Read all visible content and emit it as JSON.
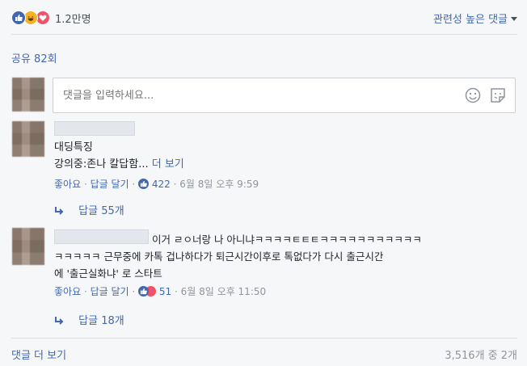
{
  "reactions": {
    "count": "1.2만명",
    "icons": [
      "like-icon",
      "haha-icon",
      "love-icon"
    ]
  },
  "sort": {
    "label": "관련성 높은 댓글"
  },
  "shares": {
    "label": "공유 82회"
  },
  "compose": {
    "placeholder": "댓글을 입력하세요..."
  },
  "comments": [
    {
      "line1": "대딩특징",
      "line2": "강의중:존나 칼답함...",
      "more": "더 보기",
      "like": "좋아요",
      "reply": "답글 달기",
      "reaction_count": "422",
      "time": "6월 8일 오후 9:59",
      "replies": "답글 55개"
    },
    {
      "line1": "이거 ㄹㅇ너랑 나 아니냐ㅋㅋㅋㅋㅌㅌㅌㅋㅋㅋㅋㅋㅋㅋㅋㅋㅋㅋ",
      "line2": "ㅋㅋㅋㅋㅋ 근무중에 카톡 겁나하다가 퇴근시간이후로 톡없다가 다시 출근시간",
      "line3": "에 '출근실화냐' 로 스타트",
      "like": "좋아요",
      "reply": "답글 달기",
      "reaction_count": "51",
      "time": "6월 8일 오후 11:50",
      "replies": "답글 18개"
    }
  ],
  "footer": {
    "more_comments": "댓글 더 보기",
    "pagination": "3,516개 중 2개"
  },
  "colors": {
    "link": "#4267b2",
    "muted": "#90949c",
    "like": "#4267b2",
    "haha": "#f7b125",
    "love": "#f25268"
  }
}
